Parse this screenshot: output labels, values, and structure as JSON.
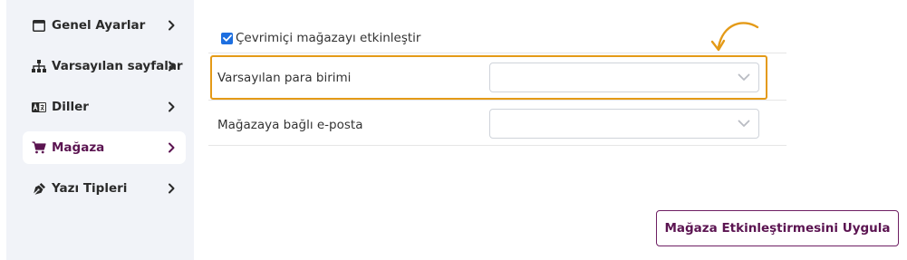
{
  "sidebar": {
    "items": [
      {
        "label": "Genel Ayarlar",
        "icon": "window-icon",
        "active": false
      },
      {
        "label": "Varsayılan sayfalar",
        "icon": "sitemap-icon",
        "active": false
      },
      {
        "label": "Diller",
        "icon": "language-icon",
        "active": false
      },
      {
        "label": "Mağaza",
        "icon": "cart-icon",
        "active": true
      },
      {
        "label": "Yazı Tipleri",
        "icon": "pen-nib-icon",
        "active": false
      }
    ]
  },
  "main": {
    "enable_store": {
      "label": "Çevrimiçi mağazayı etkinleştir",
      "checked": true
    },
    "fields": [
      {
        "label": "Varsayılan para birimi",
        "value": "",
        "highlighted": true
      },
      {
        "label": "Mağazaya bağlı e-posta",
        "value": "",
        "highlighted": false
      }
    ],
    "apply_button": "Mağaza Etkinleştirmesini Uygula"
  },
  "colors": {
    "accent": "#5b1451",
    "highlight": "#e49a17",
    "checkbox": "#1d6fe0",
    "sidebar_bg": "#f1f3f8"
  }
}
